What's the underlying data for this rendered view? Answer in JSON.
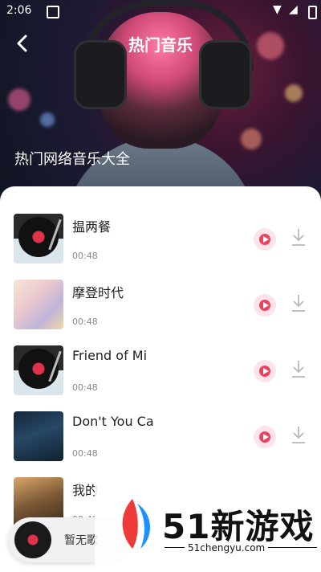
{
  "status_bar": {
    "time": "2:06"
  },
  "header": {
    "title": "热门音乐",
    "subtitle": "热门网络音乐大全"
  },
  "songs": [
    {
      "title": "揾两餐",
      "duration": "00:48",
      "art": "vinyl-art"
    },
    {
      "title": "摩登时代",
      "duration": "00:48",
      "art": "illustration-art"
    },
    {
      "title": "Friend of Mi",
      "duration": "00:48",
      "art": "vinyl-art"
    },
    {
      "title": "Don't You Ca",
      "duration": "00:48",
      "art": "band-photo-art"
    },
    {
      "title": "我的",
      "duration": "00:48",
      "art": "band-photo-art"
    }
  ],
  "mini_player": {
    "label": "暂无歌"
  },
  "watermark": {
    "brand": "51新游戏",
    "url": "51chengyu.com"
  },
  "colors": {
    "accent": "#f0405e",
    "accent_soft": "#fde4ea"
  }
}
